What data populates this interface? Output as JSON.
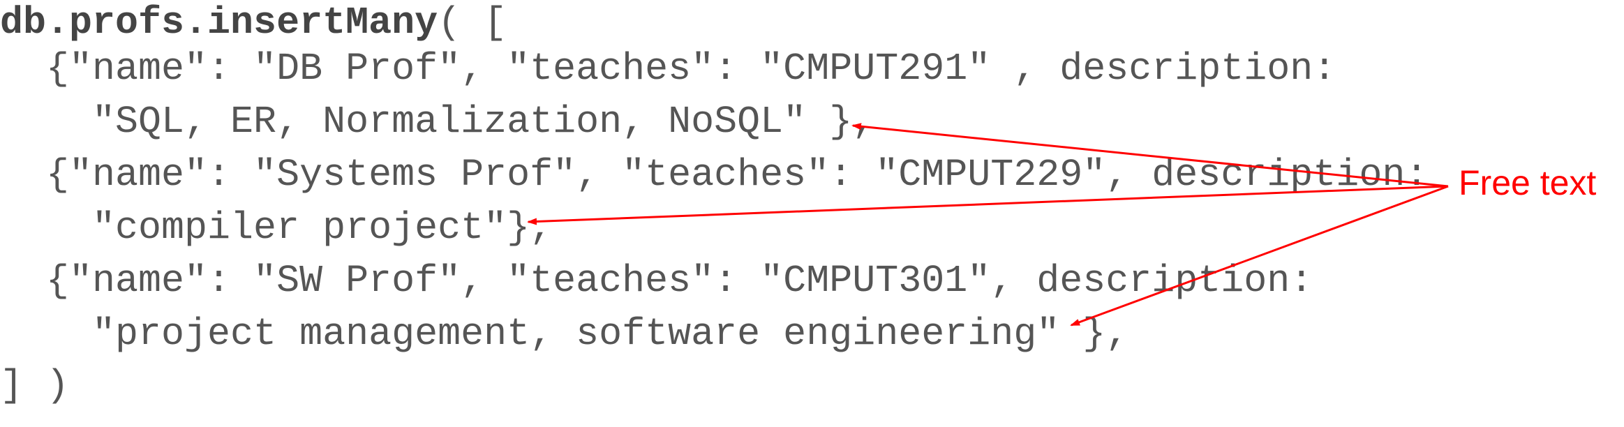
{
  "code": {
    "line1_method": "db.profs.insertMany",
    "line1_rest": "( [",
    "line2": "  {\"name\": \"DB Prof\", \"teaches\": \"CMPUT291\" , description:",
    "line3": "    \"SQL, ER, Normalization, NoSQL\" },",
    "line4": "  {\"name\": \"Systems Prof\", \"teaches\": \"CMPUT229\", description:",
    "line5": "    \"compiler project\"},",
    "line6": "  {\"name\": \"SW Prof\", \"teaches\": \"CMPUT301\", description:",
    "line7": "    \"project management, software engineering\" },",
    "line8": "] )"
  },
  "annotation": {
    "label": "Free text",
    "color": "#ff0000"
  },
  "colors": {
    "code_text": "#555555",
    "background": "#ffffff"
  }
}
